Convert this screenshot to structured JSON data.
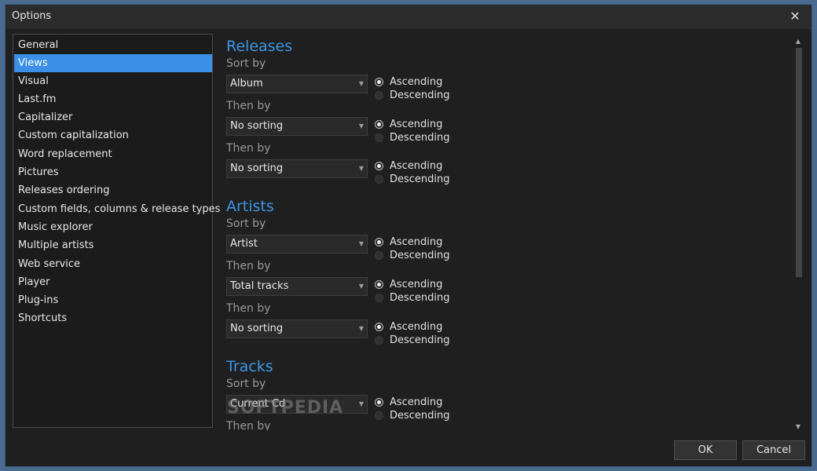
{
  "window": {
    "title": "Options"
  },
  "sidebar": {
    "items": [
      {
        "label": "General"
      },
      {
        "label": "Views"
      },
      {
        "label": "Visual"
      },
      {
        "label": "Last.fm"
      },
      {
        "label": "Capitalizer"
      },
      {
        "label": "Custom capitalization"
      },
      {
        "label": "Word replacement"
      },
      {
        "label": "Pictures"
      },
      {
        "label": "Releases ordering"
      },
      {
        "label": "Custom fields, columns & release types"
      },
      {
        "label": "Music explorer"
      },
      {
        "label": "Multiple artists"
      },
      {
        "label": "Web service"
      },
      {
        "label": "Player"
      },
      {
        "label": "Plug-ins"
      },
      {
        "label": "Shortcuts"
      }
    ],
    "selected": "Views"
  },
  "sections": [
    {
      "title": "Releases",
      "rows": [
        {
          "label": "Sort by",
          "value": "Album",
          "order": "Ascending"
        },
        {
          "label": "Then by",
          "value": "No sorting",
          "order": "Ascending"
        },
        {
          "label": "Then by",
          "value": "No sorting",
          "order": "Ascending"
        }
      ]
    },
    {
      "title": "Artists",
      "rows": [
        {
          "label": "Sort by",
          "value": "Artist",
          "order": "Ascending"
        },
        {
          "label": "Then by",
          "value": "Total tracks",
          "order": "Ascending"
        },
        {
          "label": "Then by",
          "value": "No sorting",
          "order": "Ascending"
        }
      ]
    },
    {
      "title": "Tracks",
      "rows": [
        {
          "label": "Sort by",
          "value": "Current Cd",
          "order": "Ascending"
        },
        {
          "label": "Then by",
          "value": "",
          "order": ""
        }
      ]
    }
  ],
  "radio_labels": {
    "ascending": "Ascending",
    "descending": "Descending"
  },
  "buttons": {
    "ok": "OK",
    "cancel": "Cancel"
  },
  "watermark": "SOFTPEDIA",
  "colors": {
    "accent": "#3c96e6",
    "selection": "#3b8fe6",
    "background": "#1f1f1f"
  }
}
